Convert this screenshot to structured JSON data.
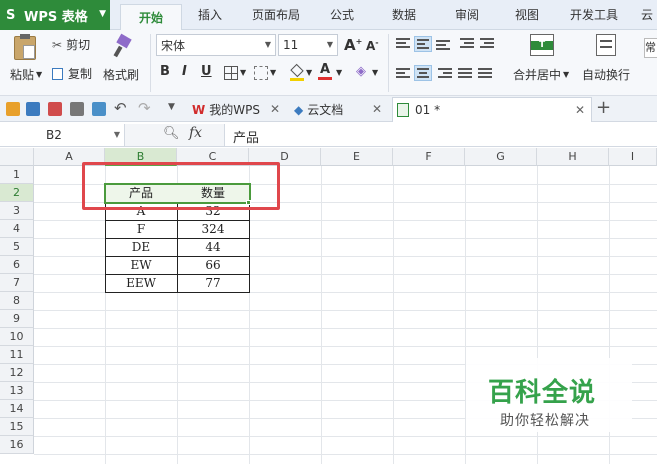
{
  "app": {
    "logo": "WPS 表格",
    "menu_tabs": [
      "开始",
      "插入",
      "页面布局",
      "公式",
      "数据",
      "审阅",
      "视图",
      "开发工具",
      "云"
    ]
  },
  "ribbon": {
    "paste": "粘贴",
    "cut": "剪切",
    "copy": "复制",
    "format_painter": "格式刷",
    "font_name": "宋体",
    "font_size": "11",
    "bold": "B",
    "italic": "I",
    "underline": "U",
    "font_color_glyph": "A",
    "grow_font": "A",
    "shrink_font": "A",
    "merge_center": "合并居中",
    "wrap_text": "自动换行",
    "far_right_fragment": "常"
  },
  "doc_tabs": [
    {
      "label": "我的WPS"
    },
    {
      "label": "云文档"
    },
    {
      "label": "01 *"
    }
  ],
  "formula_bar": {
    "cell_ref": "B2",
    "formula": "产品"
  },
  "grid": {
    "columns": [
      "A",
      "B",
      "C",
      "D",
      "E",
      "F",
      "G",
      "H",
      "I"
    ],
    "rows": [
      "1",
      "2",
      "3",
      "4",
      "5",
      "6",
      "7",
      "8",
      "9",
      "10",
      "11",
      "12",
      "13",
      "14",
      "15",
      "16"
    ],
    "table_header": [
      "产品",
      "数量"
    ],
    "table_rows": [
      [
        "A",
        "32"
      ],
      [
        "F",
        "324"
      ],
      [
        "DE",
        "44"
      ],
      [
        "EW",
        "66"
      ],
      [
        "EEW",
        "77"
      ]
    ]
  },
  "watermark": {
    "title": "百科全说",
    "subtitle": "助你轻松解决"
  },
  "colors": {
    "accent_green": "#2e8b3a",
    "highlight_red": "#e0474c",
    "selection_green": "#4a9a3c"
  }
}
